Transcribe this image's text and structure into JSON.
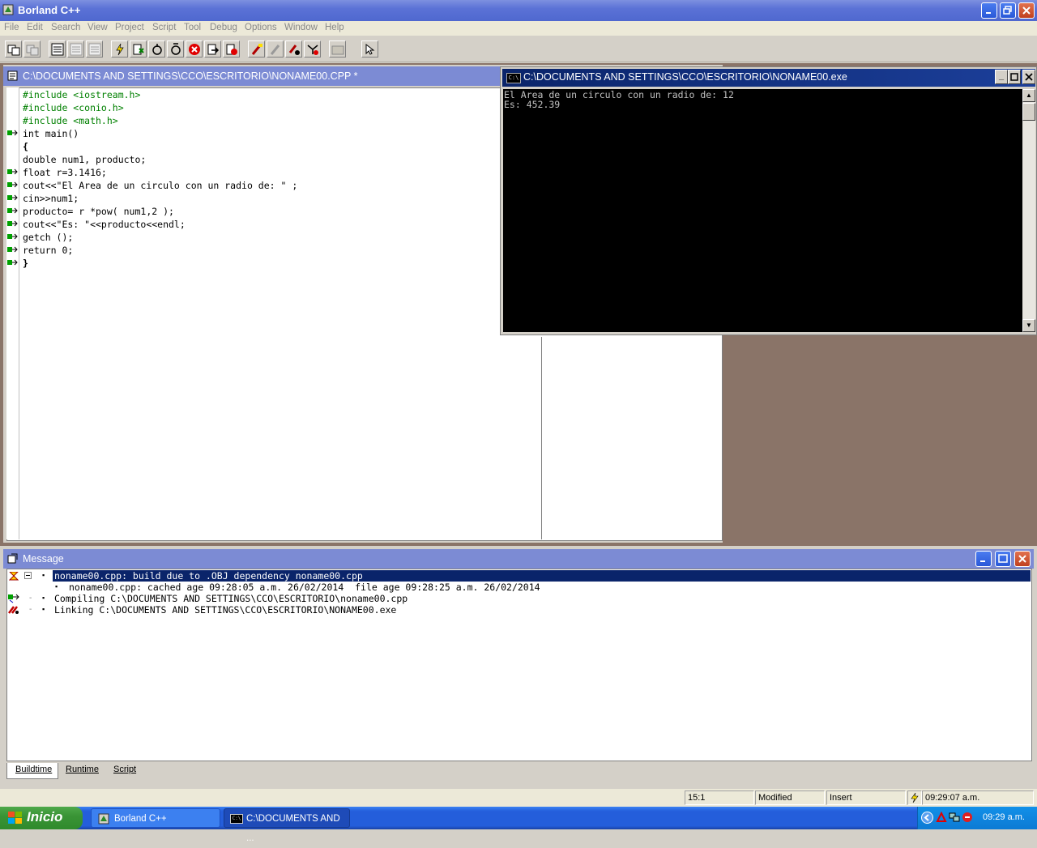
{
  "app": {
    "title": "Borland C++",
    "window_controls": [
      "minimize",
      "restore",
      "close"
    ]
  },
  "menu": [
    "File",
    "Edit",
    "Search",
    "View",
    "Project",
    "Script",
    "Tool",
    "Debug",
    "Options",
    "Window",
    "Help"
  ],
  "toolbar": {
    "icons": [
      "open-project-icon",
      "close-project-icon",
      "view-binary-icon",
      "view-disabled-icon",
      "view-disabled-2-icon",
      "make-icon",
      "build-icon",
      "compile-icon",
      "run-icon",
      "stop-icon",
      "step-over-icon",
      "trace-into-icon",
      "breakpoint-icon",
      "toggle-breakpoint-icon",
      "watch-icon",
      "inspect-icon",
      "folder-icon",
      "help-pointer-icon"
    ]
  },
  "editor": {
    "title": "C:\\DOCUMENTS AND SETTINGS\\CCO\\ESCRITORIO\\NONAME00.CPP *",
    "lines": [
      {
        "text": "#include <iostream.h>"
      },
      {
        "text": "#include <conio.h>"
      },
      {
        "text": "#include <math.h>"
      },
      {
        "text": "int main()"
      },
      {
        "text": "{"
      },
      {
        "text": "double num1, producto;"
      },
      {
        "text": "float r=3.1416;"
      },
      {
        "text": "cout<<\"El Area de un circulo con un radio de: \" ;"
      },
      {
        "text": "cin>>num1;"
      },
      {
        "text": "producto= r *pow( num1,2 );"
      },
      {
        "text": "cout<<\"Es: \"<<producto<<endl;"
      },
      {
        "text": "getch ();"
      },
      {
        "text": "return 0;"
      },
      {
        "text": "}"
      }
    ]
  },
  "console": {
    "title": "C:\\DOCUMENTS AND SETTINGS\\CCO\\ESCRITORIO\\NONAME00.exe",
    "icon_text": "C:\\",
    "output": [
      "El Area de un circulo con un radio de: 12",
      "Es: 452.39"
    ]
  },
  "messages": {
    "title": "Message",
    "items": [
      {
        "text": "noname00.cpp: build due to .OBJ dependency noname00.cpp",
        "selected": true
      },
      {
        "text": "noname00.cpp: cached age 09:28:05 a.m. 26/02/2014  file age 09:28:25 a.m. 26/02/2014",
        "selected": false
      },
      {
        "text": "Compiling C:\\DOCUMENTS AND SETTINGS\\CCO\\ESCRITORIO\\noname00.cpp",
        "selected": false
      },
      {
        "text": "Linking C:\\DOCUMENTS AND SETTINGS\\CCO\\ESCRITORIO\\NONAME00.exe",
        "selected": false
      }
    ],
    "tabs": [
      "Buildtime",
      "Runtime",
      "Script"
    ]
  },
  "status": {
    "position": "15:1",
    "modified": "Modified",
    "mode": "Insert",
    "time": "09:29:07 a.m."
  },
  "taskbar": {
    "start_label": "Inicio",
    "tasks": [
      "Borland C++",
      "C:\\DOCUMENTS AND ..."
    ],
    "clock": "09:29 a.m."
  },
  "colors": {
    "title_active": "#0a246a",
    "title_inactive": "#7c8bd4",
    "selection": "#0a246a",
    "mdi_background": "#8a7468",
    "taskbar": "#245edb",
    "start_button": "#3a9436"
  }
}
